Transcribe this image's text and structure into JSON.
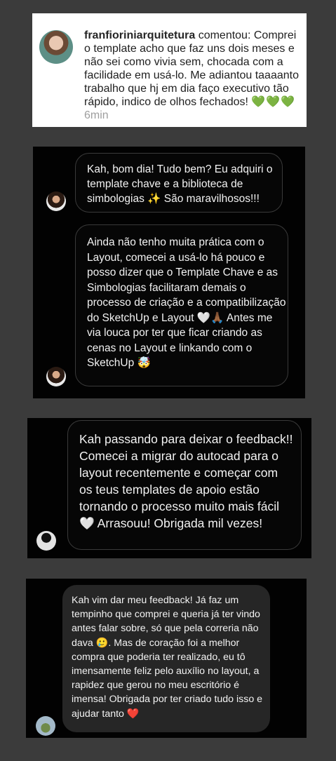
{
  "comment_card": {
    "username": "franfioriniarquitetura",
    "action": "comentou:",
    "text": "Comprei o template acho que faz uns dois meses e não sei como vivia sem, chocada com a facilidade em usá-lo. Me adiantou taaaanto trabalho que hj em dia faço executivo tão rápido, indico de olhos fechados!",
    "hearts": "💚💚💚",
    "time": "6min"
  },
  "card2": {
    "message1": "Kah, bom dia! Tudo bem? Eu adquiri o template chave e a biblioteca de simbologias ✨ São maravilhosos!!!",
    "message2": "Ainda não tenho muita prática com o Layout, comecei a usá-lo há pouco e posso dizer que o Template Chave e as Simbologias facilitaram demais o processo de criação e a compatibilização do SketchUp e Layout 🤍🙏🏾 Antes me via louca por ter que ficar criando as cenas no Layout e linkando com o SketchUp 🤯"
  },
  "card3": {
    "message": "Kah passando para deixar o feedback!! Comecei a migrar do autocad para o layout recentemente e começar com os teus templates de apoio estão tornando o processo muito mais fácil 🤍 Arrasouu! Obrigada mil vezes!"
  },
  "card4": {
    "message": "Kah vim dar meu feedback! Já faz um tempinho que comprei e queria já ter vindo antes falar sobre, só que pela correria não dava 🥲. Mas de coração foi a melhor compra que poderia ter realizado, eu tô imensamente feliz pelo auxílio no layout, a rapidez que gerou no meu escritório é imensa! Obrigada por ter criado tudo isso e ajudar tanto ❤️"
  }
}
